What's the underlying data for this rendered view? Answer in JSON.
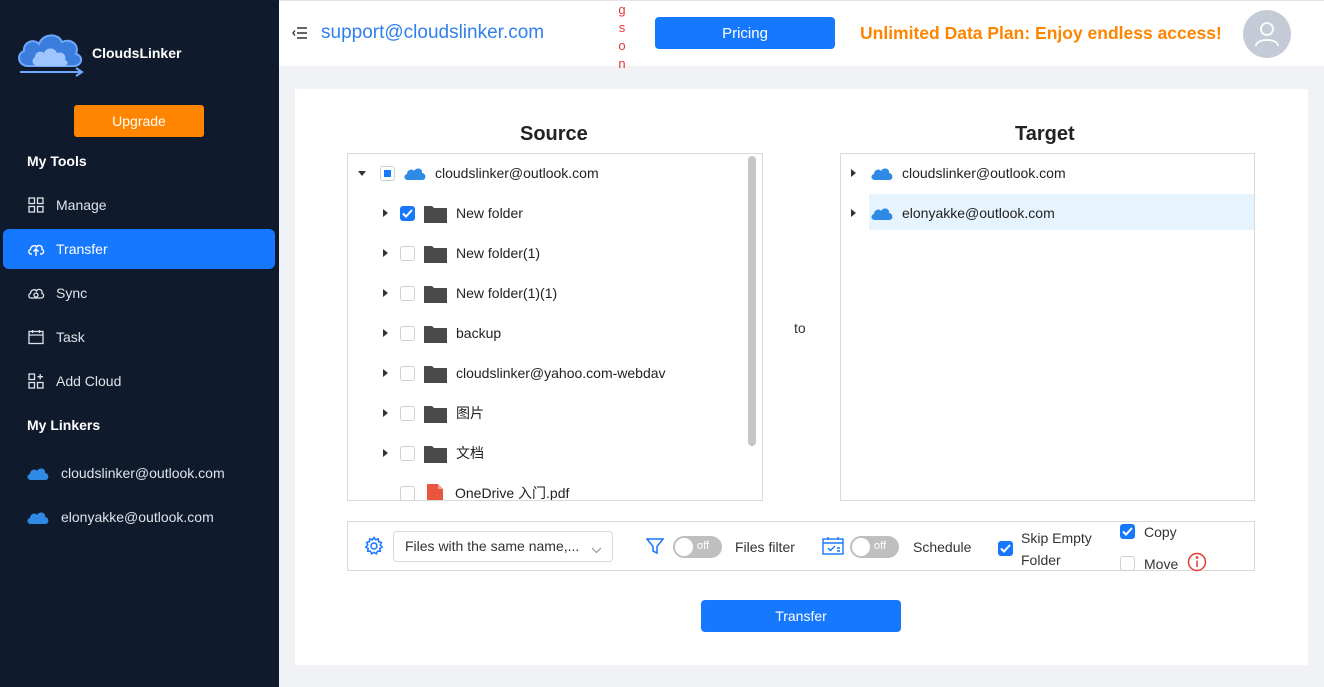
{
  "brand": {
    "name": "CloudsLinker"
  },
  "sidebar": {
    "upgrade_label": "Upgrade",
    "tools_title": "My Tools",
    "items": [
      {
        "label": "Manage",
        "icon": "grid-icon",
        "active": false
      },
      {
        "label": "Transfer",
        "icon": "cloud-upload-icon",
        "active": true
      },
      {
        "label": "Sync",
        "icon": "cloud-sync-icon",
        "active": false
      },
      {
        "label": "Task",
        "icon": "calendar-icon",
        "active": false
      },
      {
        "label": "Add Cloud",
        "icon": "add-grid-icon",
        "active": false
      }
    ],
    "linkers_title": "My Linkers",
    "linkers": [
      {
        "label": "cloudslinker@outlook.com",
        "icon": "onedrive-icon"
      },
      {
        "label": "elonyakke@outlook.com",
        "icon": "onedrive-icon"
      }
    ]
  },
  "header": {
    "support_email": "support@cloudslinker.com",
    "vertical_text": [
      "g",
      "s",
      "o",
      "n"
    ],
    "pricing_label": "Pricing",
    "promo": "Unlimited Data Plan: Enjoy endless access!"
  },
  "source": {
    "title": "Source",
    "root": "cloudslinker@outlook.com",
    "items": [
      {
        "label": "New folder",
        "type": "folder",
        "checked": true
      },
      {
        "label": "New folder(1)",
        "type": "folder",
        "checked": false
      },
      {
        "label": "New folder(1)(1)",
        "type": "folder",
        "checked": false
      },
      {
        "label": "backup",
        "type": "folder",
        "checked": false
      },
      {
        "label": "cloudslinker@yahoo.com-webdav",
        "type": "folder",
        "checked": false
      },
      {
        "label": "图片",
        "type": "folder",
        "checked": false
      },
      {
        "label": "文档",
        "type": "folder",
        "checked": false
      },
      {
        "label": "OneDrive 入门.pdf",
        "type": "pdf",
        "checked": false
      }
    ]
  },
  "to_label": "to",
  "target": {
    "title": "Target",
    "items": [
      {
        "label": "cloudslinker@outlook.com",
        "selected": false
      },
      {
        "label": "elonyakke@outlook.com",
        "selected": true
      }
    ]
  },
  "options": {
    "same_name_select": "Files with the same name,...",
    "files_filter_toggle": "off",
    "files_filter_label": "Files filter",
    "schedule_toggle": "off",
    "schedule_label": "Schedule",
    "skip_empty_line1": "Skip Empty",
    "skip_empty_line2": "Folder",
    "skip_empty_checked": true,
    "copy_label": "Copy",
    "copy_checked": true,
    "move_label": "Move",
    "move_checked": false
  },
  "transfer_label": "Transfer",
  "colors": {
    "sidebar_bg": "#0f1b2d",
    "accent": "#1677ff",
    "orange": "#ff8400"
  }
}
